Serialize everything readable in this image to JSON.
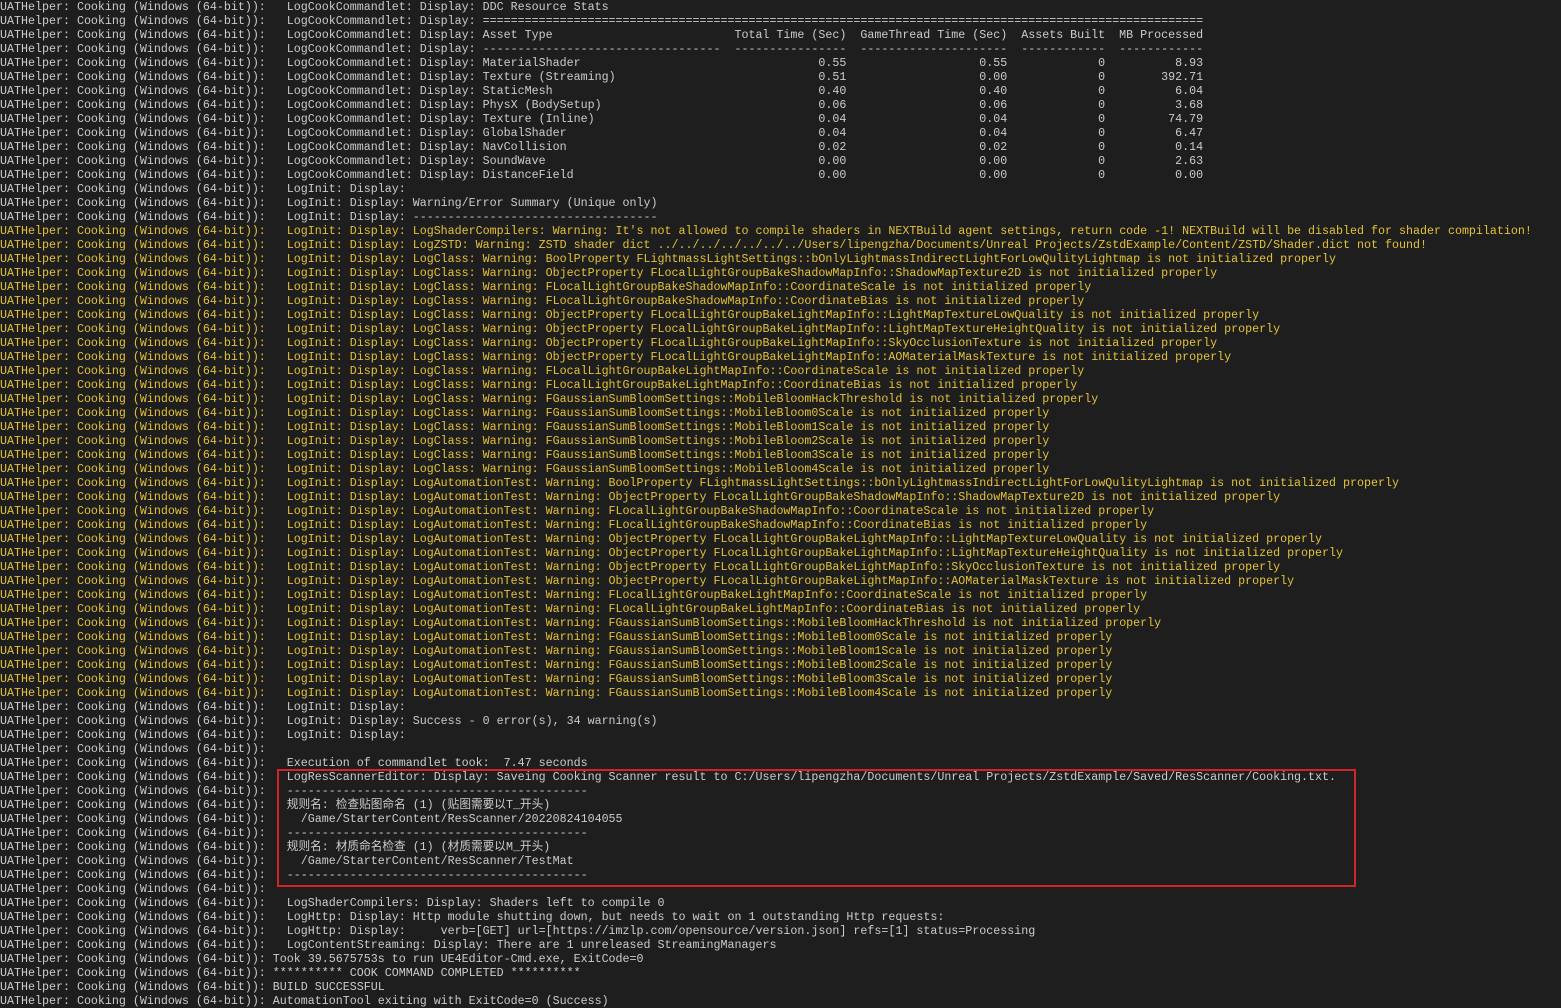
{
  "prefix": "UATHelper: Cooking (Windows (64-bit)):",
  "colors": {
    "background": "#1e1e1e",
    "text": "#cccccc",
    "warning": "#e3c23a",
    "highlight_border": "#d0232c"
  },
  "table_widths": [
    34,
    16,
    21,
    12,
    12
  ],
  "lines": [
    {
      "text": "   LogCookCommandlet: Display: DDC Resource Stats"
    },
    {
      "text": "   LogCookCommandlet: Display: ======================================================================================================="
    },
    {
      "text": "   LogCookCommandlet: Display: ",
      "cells": [
        "Asset Type",
        "Total Time (Sec)",
        "GameThread Time (Sec)",
        "Assets Built",
        "MB Processed"
      ]
    },
    {
      "text": "   LogCookCommandlet: Display: ",
      "cells": [
        "----------------------------------",
        "----------------",
        "---------------------",
        "------------",
        "------------"
      ]
    },
    {
      "text": "   LogCookCommandlet: Display: ",
      "cells": [
        "MaterialShader",
        "0.55",
        "0.55",
        "0",
        "8.93"
      ]
    },
    {
      "text": "   LogCookCommandlet: Display: ",
      "cells": [
        "Texture (Streaming)",
        "0.51",
        "0.00",
        "0",
        "392.71"
      ]
    },
    {
      "text": "   LogCookCommandlet: Display: ",
      "cells": [
        "StaticMesh",
        "0.40",
        "0.40",
        "0",
        "6.04"
      ]
    },
    {
      "text": "   LogCookCommandlet: Display: ",
      "cells": [
        "PhysX (BodySetup)",
        "0.06",
        "0.06",
        "0",
        "3.68"
      ]
    },
    {
      "text": "   LogCookCommandlet: Display: ",
      "cells": [
        "Texture (Inline)",
        "0.04",
        "0.04",
        "0",
        "74.79"
      ]
    },
    {
      "text": "   LogCookCommandlet: Display: ",
      "cells": [
        "GlobalShader",
        "0.04",
        "0.04",
        "0",
        "6.47"
      ]
    },
    {
      "text": "   LogCookCommandlet: Display: ",
      "cells": [
        "NavCollision",
        "0.02",
        "0.02",
        "0",
        "0.14"
      ]
    },
    {
      "text": "   LogCookCommandlet: Display: ",
      "cells": [
        "SoundWave",
        "0.00",
        "0.00",
        "0",
        "2.63"
      ]
    },
    {
      "text": "   LogCookCommandlet: Display: ",
      "cells": [
        "DistanceField",
        "0.00",
        "0.00",
        "0",
        "0.00"
      ]
    },
    {
      "text": "   LogInit: Display:"
    },
    {
      "text": "   LogInit: Display: Warning/Error Summary (Unique only)"
    },
    {
      "text": "   LogInit: Display: -----------------------------------"
    },
    {
      "level": "warn",
      "text": "   LogInit: Display: LogShaderCompilers: Warning: It's not allowed to compile shaders in NEXTBuild agent settings, return code -1! NEXTBuild will be disabled for shader compilation!"
    },
    {
      "level": "warn",
      "text": "   LogInit: Display: LogZSTD: Warning: ZSTD shader dict ../../../../../../../Users/lipengzha/Documents/Unreal Projects/ZstdExample/Content/ZSTD/Shader.dict not found!"
    },
    {
      "level": "warn",
      "text": "   LogInit: Display: LogClass: Warning: BoolProperty FLightmassLightSettings::bOnlyLightmassIndirectLightForLowQulityLightmap is not initialized properly"
    },
    {
      "level": "warn",
      "text": "   LogInit: Display: LogClass: Warning: ObjectProperty FLocalLightGroupBakeShadowMapInfo::ShadowMapTexture2D is not initialized properly"
    },
    {
      "level": "warn",
      "text": "   LogInit: Display: LogClass: Warning: FLocalLightGroupBakeShadowMapInfo::CoordinateScale is not initialized properly"
    },
    {
      "level": "warn",
      "text": "   LogInit: Display: LogClass: Warning: FLocalLightGroupBakeShadowMapInfo::CoordinateBias is not initialized properly"
    },
    {
      "level": "warn",
      "text": "   LogInit: Display: LogClass: Warning: ObjectProperty FLocalLightGroupBakeLightMapInfo::LightMapTextureLowQuality is not initialized properly"
    },
    {
      "level": "warn",
      "text": "   LogInit: Display: LogClass: Warning: ObjectProperty FLocalLightGroupBakeLightMapInfo::LightMapTextureHeightQuality is not initialized properly"
    },
    {
      "level": "warn",
      "text": "   LogInit: Display: LogClass: Warning: ObjectProperty FLocalLightGroupBakeLightMapInfo::SkyOcclusionTexture is not initialized properly"
    },
    {
      "level": "warn",
      "text": "   LogInit: Display: LogClass: Warning: ObjectProperty FLocalLightGroupBakeLightMapInfo::AOMaterialMaskTexture is not initialized properly"
    },
    {
      "level": "warn",
      "text": "   LogInit: Display: LogClass: Warning: FLocalLightGroupBakeLightMapInfo::CoordinateScale is not initialized properly"
    },
    {
      "level": "warn",
      "text": "   LogInit: Display: LogClass: Warning: FLocalLightGroupBakeLightMapInfo::CoordinateBias is not initialized properly"
    },
    {
      "level": "warn",
      "text": "   LogInit: Display: LogClass: Warning: FGaussianSumBloomSettings::MobileBloomHackThreshold is not initialized properly"
    },
    {
      "level": "warn",
      "text": "   LogInit: Display: LogClass: Warning: FGaussianSumBloomSettings::MobileBloom0Scale is not initialized properly"
    },
    {
      "level": "warn",
      "text": "   LogInit: Display: LogClass: Warning: FGaussianSumBloomSettings::MobileBloom1Scale is not initialized properly"
    },
    {
      "level": "warn",
      "text": "   LogInit: Display: LogClass: Warning: FGaussianSumBloomSettings::MobileBloom2Scale is not initialized properly"
    },
    {
      "level": "warn",
      "text": "   LogInit: Display: LogClass: Warning: FGaussianSumBloomSettings::MobileBloom3Scale is not initialized properly"
    },
    {
      "level": "warn",
      "text": "   LogInit: Display: LogClass: Warning: FGaussianSumBloomSettings::MobileBloom4Scale is not initialized properly"
    },
    {
      "level": "warn",
      "text": "   LogInit: Display: LogAutomationTest: Warning: BoolProperty FLightmassLightSettings::bOnlyLightmassIndirectLightForLowQulityLightmap is not initialized properly"
    },
    {
      "level": "warn",
      "text": "   LogInit: Display: LogAutomationTest: Warning: ObjectProperty FLocalLightGroupBakeShadowMapInfo::ShadowMapTexture2D is not initialized properly"
    },
    {
      "level": "warn",
      "text": "   LogInit: Display: LogAutomationTest: Warning: FLocalLightGroupBakeShadowMapInfo::CoordinateScale is not initialized properly"
    },
    {
      "level": "warn",
      "text": "   LogInit: Display: LogAutomationTest: Warning: FLocalLightGroupBakeShadowMapInfo::CoordinateBias is not initialized properly"
    },
    {
      "level": "warn",
      "text": "   LogInit: Display: LogAutomationTest: Warning: ObjectProperty FLocalLightGroupBakeLightMapInfo::LightMapTextureLowQuality is not initialized properly"
    },
    {
      "level": "warn",
      "text": "   LogInit: Display: LogAutomationTest: Warning: ObjectProperty FLocalLightGroupBakeLightMapInfo::LightMapTextureHeightQuality is not initialized properly"
    },
    {
      "level": "warn",
      "text": "   LogInit: Display: LogAutomationTest: Warning: ObjectProperty FLocalLightGroupBakeLightMapInfo::SkyOcclusionTexture is not initialized properly"
    },
    {
      "level": "warn",
      "text": "   LogInit: Display: LogAutomationTest: Warning: ObjectProperty FLocalLightGroupBakeLightMapInfo::AOMaterialMaskTexture is not initialized properly"
    },
    {
      "level": "warn",
      "text": "   LogInit: Display: LogAutomationTest: Warning: FLocalLightGroupBakeLightMapInfo::CoordinateScale is not initialized properly"
    },
    {
      "level": "warn",
      "text": "   LogInit: Display: LogAutomationTest: Warning: FLocalLightGroupBakeLightMapInfo::CoordinateBias is not initialized properly"
    },
    {
      "level": "warn",
      "text": "   LogInit: Display: LogAutomationTest: Warning: FGaussianSumBloomSettings::MobileBloomHackThreshold is not initialized properly"
    },
    {
      "level": "warn",
      "text": "   LogInit: Display: LogAutomationTest: Warning: FGaussianSumBloomSettings::MobileBloom0Scale is not initialized properly"
    },
    {
      "level": "warn",
      "text": "   LogInit: Display: LogAutomationTest: Warning: FGaussianSumBloomSettings::MobileBloom1Scale is not initialized properly"
    },
    {
      "level": "warn",
      "text": "   LogInit: Display: LogAutomationTest: Warning: FGaussianSumBloomSettings::MobileBloom2Scale is not initialized properly"
    },
    {
      "level": "warn",
      "text": "   LogInit: Display: LogAutomationTest: Warning: FGaussianSumBloomSettings::MobileBloom3Scale is not initialized properly"
    },
    {
      "level": "warn",
      "text": "   LogInit: Display: LogAutomationTest: Warning: FGaussianSumBloomSettings::MobileBloom4Scale is not initialized properly"
    },
    {
      "text": "   LogInit: Display:"
    },
    {
      "text": "   LogInit: Display: Success - 0 error(s), 34 warning(s)"
    },
    {
      "text": "   LogInit: Display:"
    },
    {
      "text": ""
    },
    {
      "text": "   Execution of commandlet took:  7.47 seconds"
    },
    {
      "text": "   LogResScannerEditor: Display: Saveing Cooking Scanner result to C:/Users/lipengzha/Documents/Unreal Projects/ZstdExample/Saved/ResScanner/Cooking.txt."
    },
    {
      "text": "   -------------------------------------------"
    },
    {
      "text": "   规则名: 检查贴图命名 (1) (贴图需要以T_开头)"
    },
    {
      "text": "     /Game/StarterContent/ResScanner/20220824104055"
    },
    {
      "text": "   -------------------------------------------"
    },
    {
      "text": "   规则名: 材质命名检查 (1) (材质需要以M_开头)"
    },
    {
      "text": "     /Game/StarterContent/ResScanner/TestMat"
    },
    {
      "text": "   -------------------------------------------"
    },
    {
      "text": ""
    },
    {
      "text": "   LogShaderCompilers: Display: Shaders left to compile 0"
    },
    {
      "text": "   LogHttp: Display: Http module shutting down, but needs to wait on 1 outstanding Http requests:"
    },
    {
      "text": "   LogHttp: Display:     verb=[GET] url=[https://imzlp.com/opensource/version.json] refs=[1] status=Processing"
    },
    {
      "text": "   LogContentStreaming: Display: There are 1 unreleased StreamingManagers"
    },
    {
      "text": " Took 39.5675753s to run UE4Editor-Cmd.exe, ExitCode=0"
    },
    {
      "text": " ********** COOK COMMAND COMPLETED **********"
    },
    {
      "text": " BUILD SUCCESSFUL"
    },
    {
      "text": " AutomationTool exiting with ExitCode=0 (Success)"
    }
  ]
}
